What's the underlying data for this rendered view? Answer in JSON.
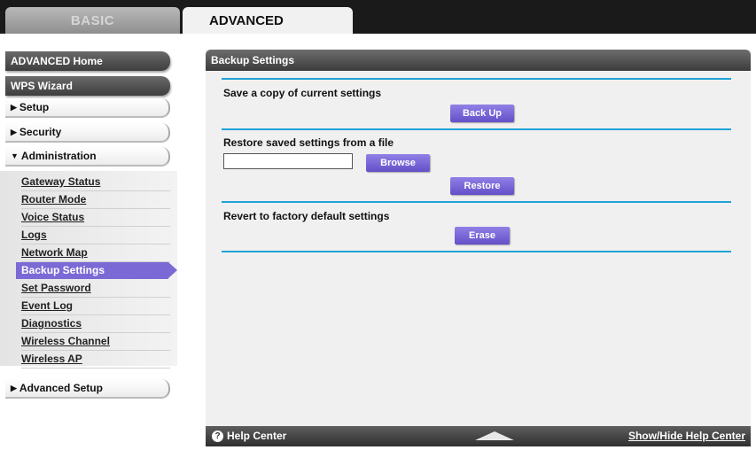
{
  "tabs": {
    "basic": "BASIC",
    "advanced": "ADVANCED"
  },
  "sidebar": {
    "advanced_home": "ADVANCED Home",
    "wps_wizard": "WPS Wizard",
    "setup": "Setup",
    "security": "Security",
    "administration": "Administration",
    "admin_items": [
      "Gateway Status",
      "Router Mode",
      "Voice Status",
      "Logs",
      "Network Map",
      "Backup Settings",
      "Set Password",
      "Event Log",
      "Diagnostics",
      "Wireless Channel",
      "Wireless AP"
    ],
    "active_item": "Backup Settings",
    "advanced_setup": "Advanced Setup"
  },
  "main": {
    "title": "Backup Settings",
    "save_label": "Save a copy of current settings",
    "backup_button": "Back Up",
    "restore_label": "Restore saved settings from a file",
    "file_value": "",
    "browse_button": "Browse",
    "restore_button": "Restore",
    "revert_label": "Revert to factory default settings",
    "erase_button": "Erase"
  },
  "footer": {
    "help_center": "Help Center",
    "help_icon_glyph": "?",
    "show_hide": "Show/Hide Help Center"
  },
  "colors": {
    "accent_purple": "#7b69d6",
    "rule_blue": "#1fa3d6",
    "header_dark": "#3c3c3c"
  }
}
